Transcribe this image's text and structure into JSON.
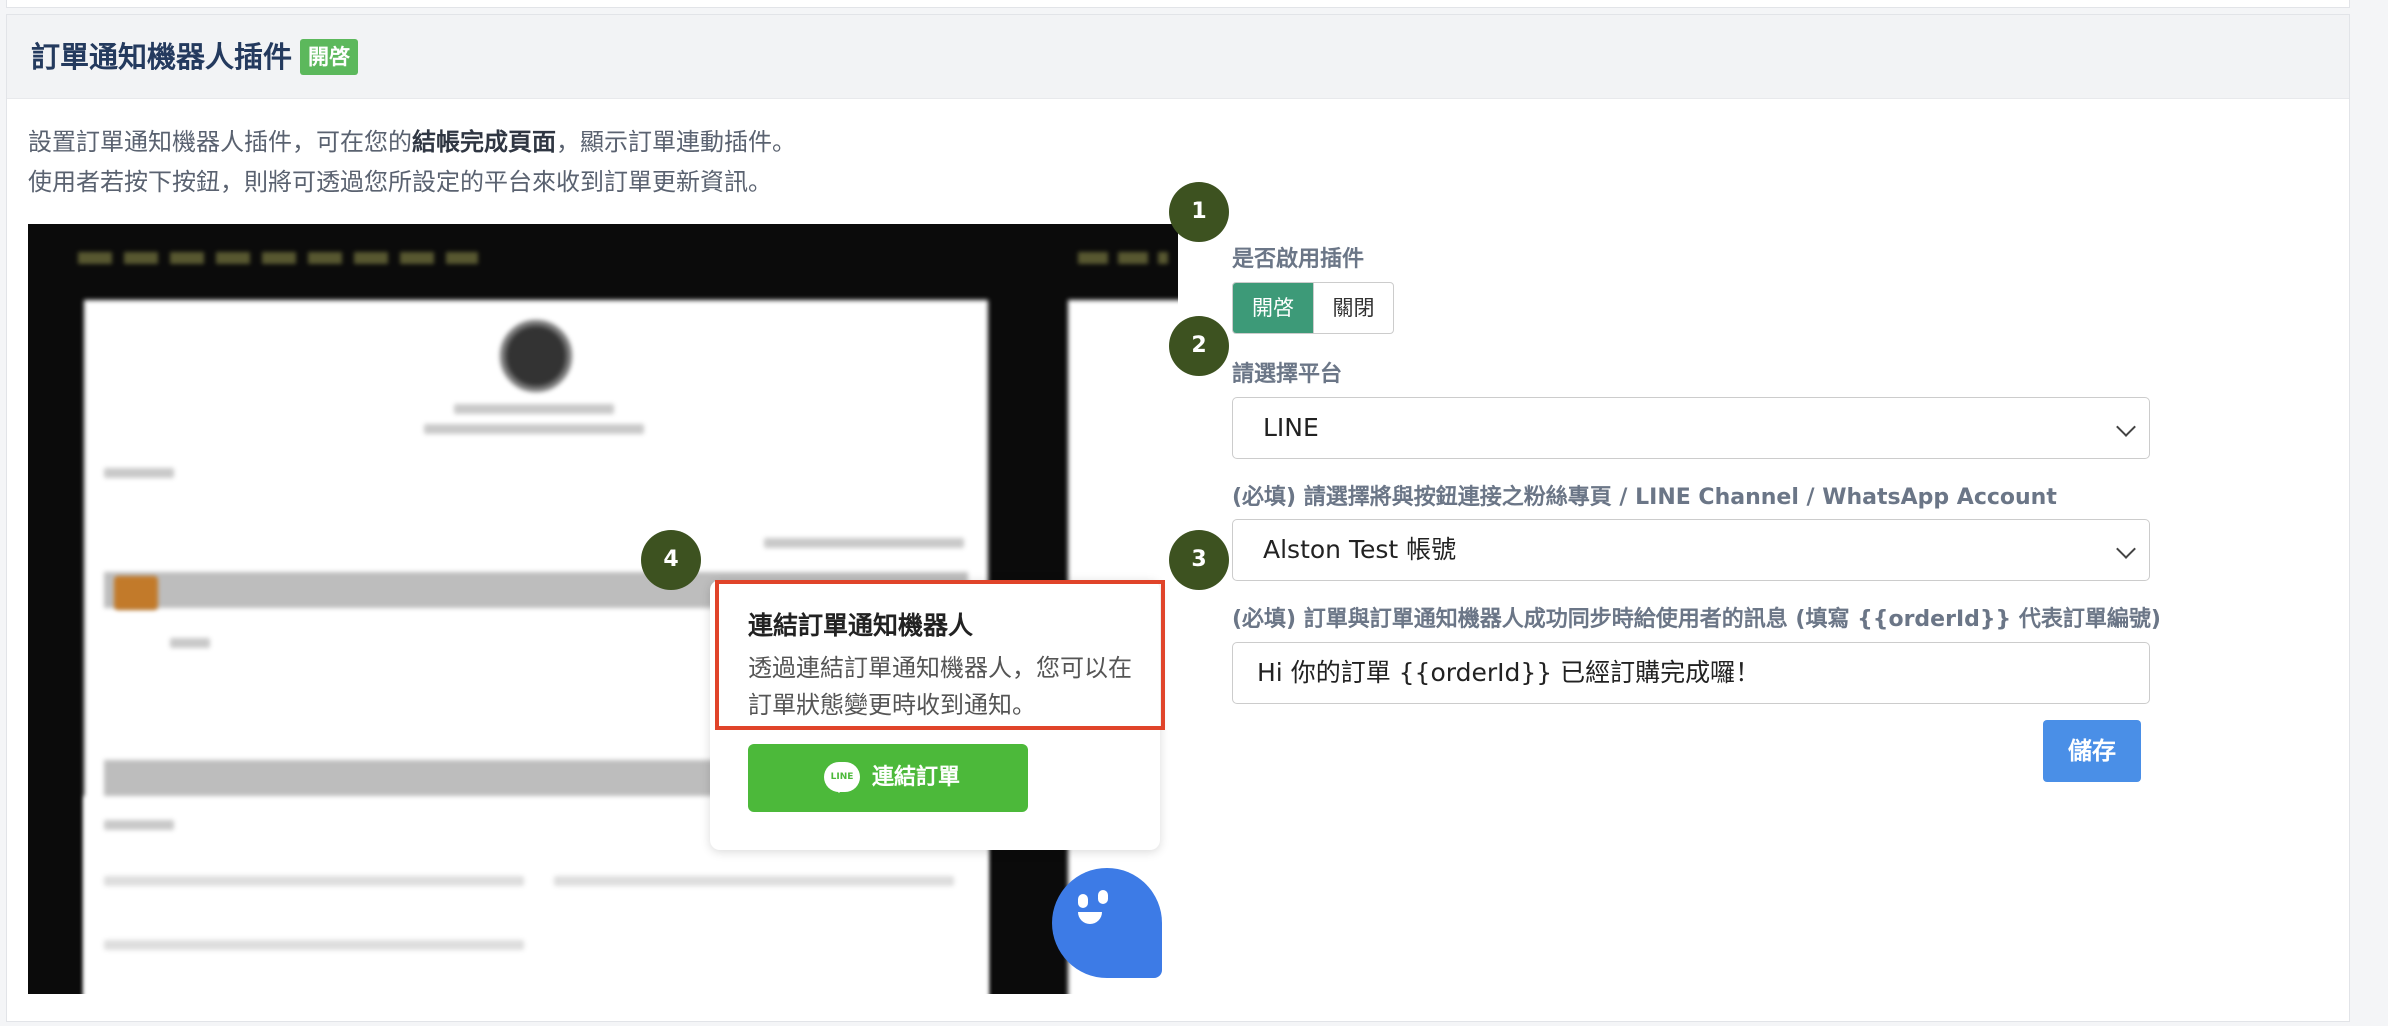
{
  "card": {
    "title": "訂單通知機器人插件",
    "status_badge": "開啓",
    "description_line1_a": "設置訂單通知機器人插件，可在您的",
    "description_line1_bold": "結帳完成頁面",
    "description_line1_b": "，顯示訂單連動插件。",
    "description_line2": "使用者若按下按鈕，則將可透過您所設定的平台來收到訂單更新資訊。"
  },
  "preview": {
    "bubble_title": "連結訂單通知機器人",
    "bubble_text": "透過連結訂單通知機器人，您可以在訂單狀態變更時收到通知。",
    "line_button_label": "連結訂單",
    "line_icon_text": "LINE",
    "mascot_icon": "chat-bot-mascot-icon"
  },
  "steps": [
    "1",
    "2",
    "3",
    "4"
  ],
  "form": {
    "enable_label": "是否啟用插件",
    "enable_on": "開啓",
    "enable_off": "關閉",
    "platform_label": "請選擇平台",
    "platform_value": "LINE",
    "account_label": "(必填) 請選擇將與按鈕連接之粉絲專頁 / LINE Channel / WhatsApp Account",
    "account_value": "Alston Test 帳號",
    "message_label": "(必填) 訂單與訂單通知機器人成功同步時給使用者的訊息 (填寫 {{orderId}} 代表訂單編號)",
    "message_value": "Hi 你的訂單 {{orderId}} 已經訂購完成囉！",
    "save_label": "儲存"
  },
  "colors": {
    "accent_green": "#3d9a78",
    "badge_green": "#5cb85c",
    "line_green": "#4cb93a",
    "step_circle": "#3d5220",
    "save_blue": "#4a8fe7",
    "highlight_red": "#e0442a"
  }
}
